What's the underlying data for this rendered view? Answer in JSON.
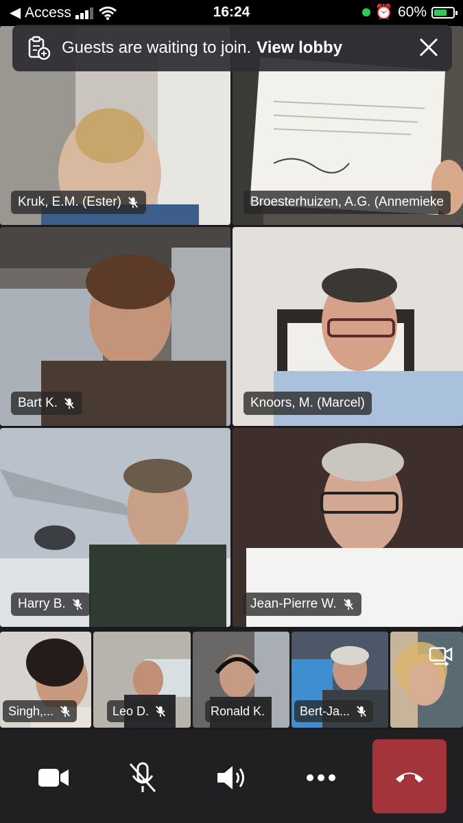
{
  "status_bar": {
    "carrier": "Access",
    "time": "16:24",
    "battery": "60%"
  },
  "banner": {
    "message": "Guests are waiting to join.",
    "link": "View lobby",
    "icon": "clipboard-add-icon"
  },
  "participants": [
    {
      "name": "Kruk, E.M. (Ester)",
      "muted": true
    },
    {
      "name": "Broesterhuizen, A.G. (Annemieke",
      "muted": false
    },
    {
      "name": "Bart K.",
      "muted": true
    },
    {
      "name": "Knoors, M. (Marcel)",
      "muted": false
    },
    {
      "name": "Harry B.",
      "muted": true
    },
    {
      "name": "Jean-Pierre W.",
      "muted": true
    }
  ],
  "strip": [
    {
      "name": "Singh,...",
      "muted": true
    },
    {
      "name": "Leo D.",
      "muted": true
    },
    {
      "name": "Ronald K.",
      "muted": false
    },
    {
      "name": "Bert-Ja...",
      "muted": true
    },
    {
      "name": "",
      "muted": false
    }
  ],
  "toolbar": {
    "camera": "video-camera-icon",
    "mic": "microphone-off-icon",
    "speaker": "speaker-icon",
    "more": "more-icon",
    "hangup": "hang-up-icon"
  },
  "colors": {
    "hangup": "#a4343c",
    "speaking_border": "#6b6fb8",
    "battery": "#34c759"
  }
}
